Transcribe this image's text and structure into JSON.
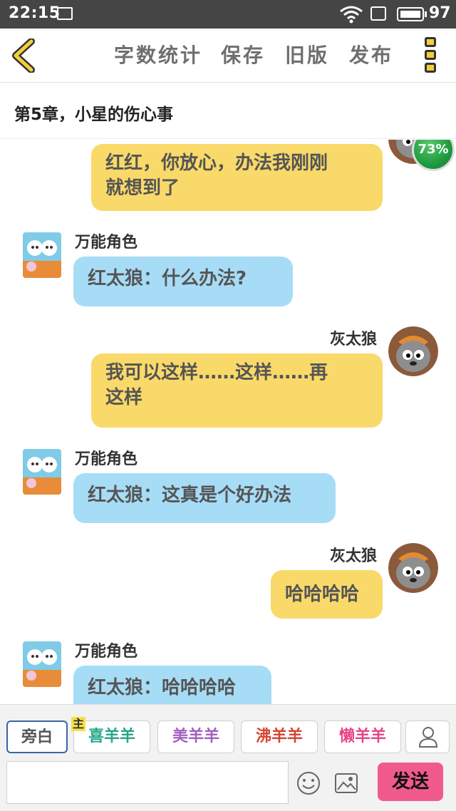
{
  "status_bar": {
    "time": "22:15",
    "battery": "97"
  },
  "toolbar": {
    "word_count": "字数统计",
    "save": "保存",
    "old_version": "旧版",
    "publish": "发布"
  },
  "chapter": {
    "title": "第5章，小星的伤心事"
  },
  "progress": {
    "label": "73%",
    "value": 73
  },
  "messages": [
    {
      "side": "right",
      "speaker": "",
      "text_line1": "红红，你放心，办法我刚刚",
      "text_line2": "就想到了"
    },
    {
      "side": "left",
      "speaker": "万能角色",
      "text": "红太狼：什么办法?"
    },
    {
      "side": "right",
      "speaker": "灰太狼",
      "text_line1": "我可以这样……这样……再",
      "text_line2": "这样"
    },
    {
      "side": "left",
      "speaker": "万能角色",
      "text": "红太狼：这真是个好办法"
    },
    {
      "side": "right",
      "speaker": "灰太狼",
      "text": "哈哈哈哈"
    },
    {
      "side": "left",
      "speaker": "万能角色",
      "text": "红太狼：哈哈哈哈"
    }
  ],
  "roles": {
    "narration": "旁白",
    "main_tag": "主",
    "items": [
      {
        "label": "喜羊羊",
        "color": "#27a58c"
      },
      {
        "label": "美羊羊",
        "color": "#a45fbf"
      },
      {
        "label": "沸羊羊",
        "color": "#d8432f"
      },
      {
        "label": "懒羊羊",
        "color": "#e6458a"
      }
    ]
  },
  "input": {
    "placeholder": "",
    "send_label": "发送"
  },
  "colors": {
    "right_bubble": "#f9d969",
    "left_bubble": "#a7dcf6",
    "send": "#f15a8c"
  }
}
